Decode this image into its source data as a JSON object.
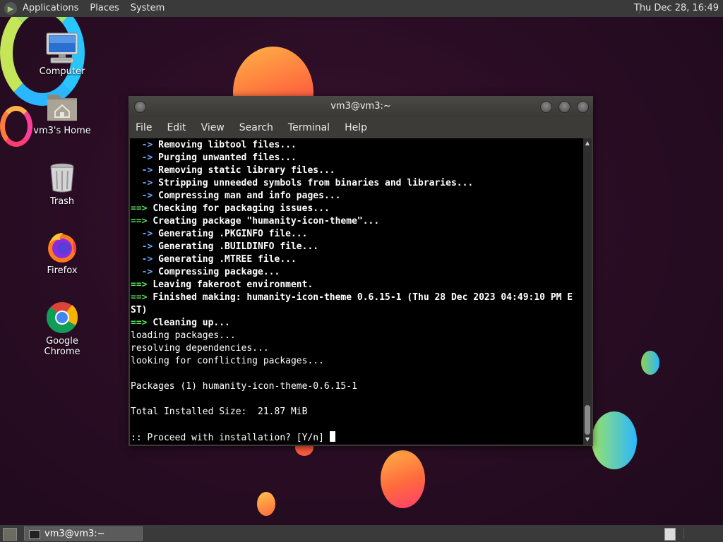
{
  "top_panel": {
    "menus": [
      "Applications",
      "Places",
      "System"
    ],
    "clock": "Thu Dec 28, 16:49"
  },
  "desktop_icons": [
    {
      "label": "Computer",
      "icon": "computer-icon"
    },
    {
      "label": "vm3's Home",
      "icon": "home-folder-icon"
    },
    {
      "label": "Trash",
      "icon": "trash-icon"
    },
    {
      "label": "Firefox",
      "icon": "firefox-icon"
    },
    {
      "label": "Google Chrome",
      "icon": "chrome-icon"
    }
  ],
  "terminal": {
    "title": "vm3@vm3:~",
    "menu": [
      "File",
      "Edit",
      "View",
      "Search",
      "Terminal",
      "Help"
    ],
    "lines": [
      {
        "prefix": "  -> ",
        "kind": "blue",
        "text": "Removing libtool files..."
      },
      {
        "prefix": "  -> ",
        "kind": "blue",
        "text": "Purging unwanted files..."
      },
      {
        "prefix": "  -> ",
        "kind": "blue",
        "text": "Removing static library files..."
      },
      {
        "prefix": "  -> ",
        "kind": "blue",
        "text": "Stripping unneeded symbols from binaries and libraries..."
      },
      {
        "prefix": "  -> ",
        "kind": "blue",
        "text": "Compressing man and info pages..."
      },
      {
        "prefix": "==> ",
        "kind": "green",
        "text": "Checking for packaging issues..."
      },
      {
        "prefix": "==> ",
        "kind": "green",
        "text": "Creating package \"humanity-icon-theme\"..."
      },
      {
        "prefix": "  -> ",
        "kind": "blue",
        "text": "Generating .PKGINFO file..."
      },
      {
        "prefix": "  -> ",
        "kind": "blue",
        "text": "Generating .BUILDINFO file..."
      },
      {
        "prefix": "  -> ",
        "kind": "blue",
        "text": "Generating .MTREE file..."
      },
      {
        "prefix": "  -> ",
        "kind": "blue",
        "text": "Compressing package..."
      },
      {
        "prefix": "==> ",
        "kind": "green",
        "text": "Leaving fakeroot environment."
      },
      {
        "prefix": "==> ",
        "kind": "green",
        "text": "Finished making: humanity-icon-theme 0.6.15-1 (Thu 28 Dec 2023 04:49:10 PM E"
      },
      {
        "prefix": "",
        "kind": "bold",
        "text": "ST)"
      },
      {
        "prefix": "==> ",
        "kind": "green",
        "text": "Cleaning up..."
      },
      {
        "prefix": "",
        "kind": "plain",
        "text": "loading packages..."
      },
      {
        "prefix": "",
        "kind": "plain",
        "text": "resolving dependencies..."
      },
      {
        "prefix": "",
        "kind": "plain",
        "text": "looking for conflicting packages..."
      },
      {
        "prefix": "",
        "kind": "plain",
        "text": ""
      },
      {
        "prefix": "",
        "kind": "plain",
        "text": "Packages (1) humanity-icon-theme-0.6.15-1"
      },
      {
        "prefix": "",
        "kind": "plain",
        "text": ""
      },
      {
        "prefix": "",
        "kind": "plain",
        "text": "Total Installed Size:  21.87 MiB"
      },
      {
        "prefix": "",
        "kind": "plain",
        "text": ""
      },
      {
        "prefix": "",
        "kind": "prompt",
        "text": ":: Proceed with installation? [Y/n] "
      }
    ]
  },
  "taskbar": {
    "window_button": "vm3@vm3:~"
  }
}
